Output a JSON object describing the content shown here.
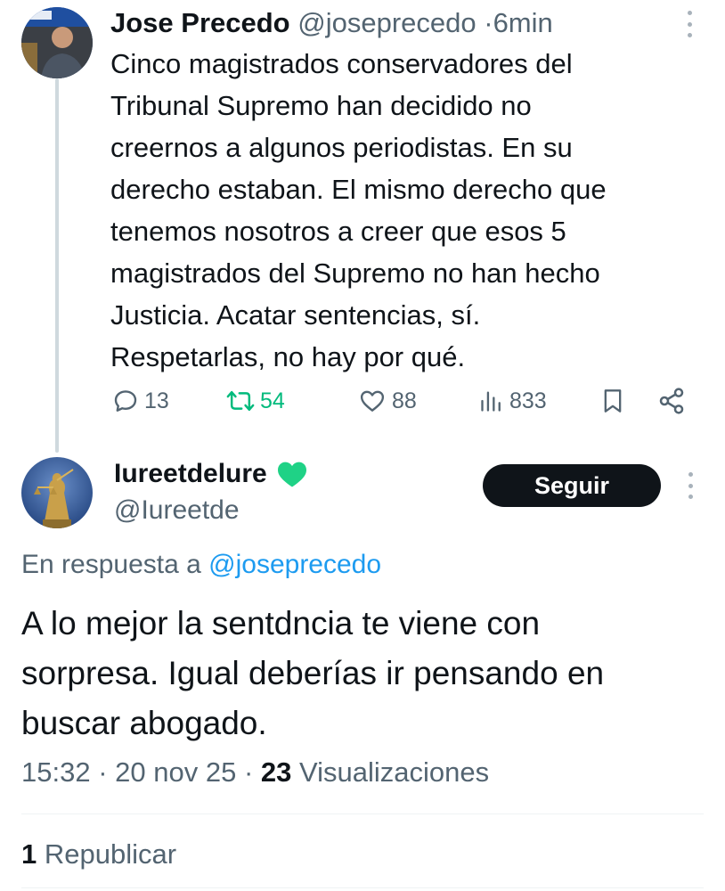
{
  "parent_tweet": {
    "author_name": "Jose Precedo",
    "author_handle": "@joseprecedo",
    "separator": "·",
    "time": "6min",
    "text_lines": [
      "Cinco magistrados conservadores del",
      "Tribunal Supremo han decidido no",
      "creernos a algunos periodistas. En su",
      "derecho estaban. El mismo derecho que",
      "tenemos nosotros a creer que esos 5",
      "magistrados del Supremo no han hecho",
      "Justicia. Acatar sentencias, sí.",
      "Respetarlas, no hay por qué."
    ],
    "actions": {
      "replies": "13",
      "reposts": "54",
      "likes": "88",
      "views": "833"
    },
    "icons": [
      "reply-icon",
      "repost-icon",
      "like-icon",
      "views-icon",
      "bookmark-icon",
      "share-icon"
    ]
  },
  "reply_tweet": {
    "author_name": "Iureetdelure",
    "author_handle": "@Iureetde",
    "follow_label": "Seguir",
    "reply_prefix": "En respuesta a",
    "reply_to_handle": "@joseprecedo",
    "text_lines": [
      "A lo mejor la sentdncia te viene con",
      "sorpresa. Igual deberías ir pensando en",
      "buscar abogado."
    ],
    "time": "15:32",
    "date": "20 nov 25",
    "separator": "·",
    "views_count": "23",
    "views_label": "Visualizaciones",
    "reposts_count": "1",
    "reposts_label": "Republicar"
  },
  "colors": {
    "text": "#0f1419",
    "secondary": "#536471",
    "link": "#1d9bf0",
    "repost_green": "#00ba7c",
    "heart_green": "#1fd286",
    "divider": "#eff3f4"
  }
}
